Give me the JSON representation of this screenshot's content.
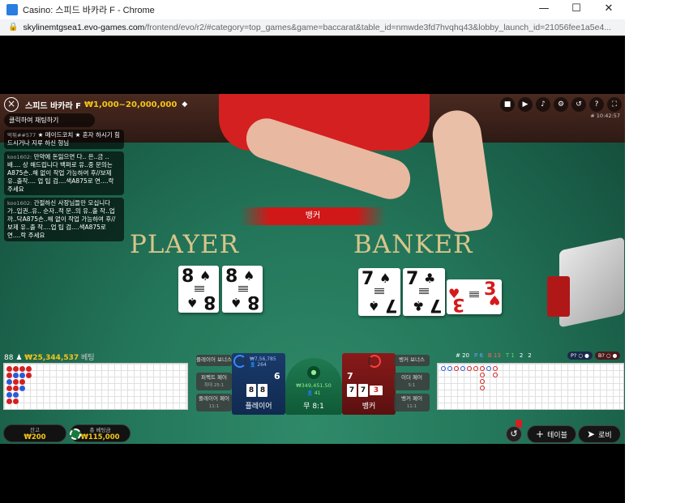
{
  "window": {
    "title": "Casino: 스피드 바카라 F - Chrome",
    "url_host": "skylinemtgsea1.evo-games.com",
    "url_path": "/frontend/evo/r2/#category=top_games&game=baccarat&table_id=nmwde3fd7hvqhq43&lobby_launch_id=21056fee1a5e4..."
  },
  "game": {
    "name": "스피드 바카라 F",
    "limits": "₩1,000~20,000,000",
    "time": "# 10:42:57"
  },
  "chat": {
    "prompt": "클릭하여 채팅하기",
    "messages": [
      {
        "user": "먹튀##577",
        "text": "★ 메이드코치 ★ 혼자 하시기 힘드시거나 지루 하신 형님"
      },
      {
        "user": "koo1602:",
        "text": "만약에 돈잃으면 다.. 은..금 ..배.... 상 해드립니다 백퍼로 유..중 문의는A875손..해 없이 작업 가능하여 후//보제 유..출작.... 업 팁 검....색A875로 연....락 주세요"
      },
      {
        "user": "koo1602:",
        "text": "간절하신 사장님들만 모십니다 가..입권..유.. 순자..적 문..의 유..출 작..업 까..닥A875손..해 없이 작업 가능하여 후//보제 유..출 작....업 팁 검....색A875로 연....락 주세요"
      }
    ]
  },
  "table": {
    "result_label": "뱅커",
    "player_label": "PLAYER",
    "banker_label": "BANKER",
    "player_cards": [
      {
        "rank": "8",
        "suit": "♠",
        "color": "black"
      },
      {
        "rank": "8",
        "suit": "♠",
        "color": "black"
      }
    ],
    "banker_cards": [
      {
        "rank": "7",
        "suit": "♠",
        "color": "black"
      },
      {
        "rank": "7",
        "suit": "♣",
        "color": "black"
      },
      {
        "rank": "3",
        "suit": "♥",
        "color": "red"
      }
    ]
  },
  "info": {
    "players": "88",
    "amount": "₩25,344,537",
    "unit": "베팅"
  },
  "stats": {
    "games": "# 20",
    "p": "P 6",
    "b": "B 13",
    "t": "T 1",
    "pp": "2",
    "bp": "2",
    "p_btn": "P? ○ ●",
    "b_btn": "B? ○ ●"
  },
  "betting": {
    "player_pair": "플레이어 보너스",
    "either_pair": "퍼펙트 페어",
    "either_pair_sub": "최대 25:1",
    "player_pair2": "플레이어 페어",
    "player_pair2_sub": "11:1",
    "banker_bonus": "뱅커 보너스",
    "either": "이더 페어",
    "either_sub": "5:1",
    "banker_pair": "뱅커 페어",
    "banker_pair_sub": "11:1",
    "player_zone": "플레이어",
    "player_score": "6",
    "player_stat": "₩7,56,785",
    "player_stat2": "👤 264",
    "player_mini": [
      "8",
      "8"
    ],
    "tie_zone": "무 8:1",
    "tie_amt": "₩349,451.50",
    "tie_sub": "👤 41",
    "banker_zone": "뱅커",
    "banker_score": "7",
    "banker_mini": [
      "7",
      "7",
      "3"
    ]
  },
  "footer": {
    "balance_label": "잔고",
    "balance": "₩200",
    "total_bet_label": "총 베팅금",
    "total_bet": "₩115,000",
    "table_btn": "테이블",
    "lobby_btn": "로비"
  }
}
